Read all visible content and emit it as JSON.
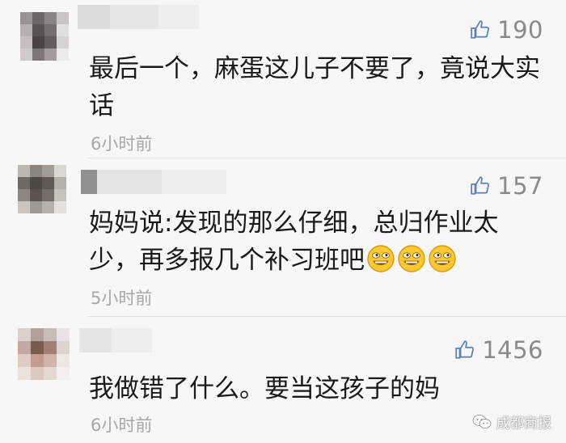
{
  "comments": [
    {
      "likes": "190",
      "text": "最后一个，麻蛋这儿子不要了，竟说大实话",
      "time": "6小时前"
    },
    {
      "likes": "157",
      "text": "妈妈说:发现的那么仔细，总归作业太少，再多报几个补习班吧",
      "time": "5小时前",
      "emoji": [
        "grinning-face",
        "grinning-face",
        "grinning-face"
      ]
    },
    {
      "likes": "1456",
      "text": "我做错了什么。要当这孩子的妈",
      "time": "6小时前"
    }
  ],
  "watermark": {
    "label": "成都商报",
    "icon": "wechat-icon"
  },
  "colors": {
    "background": "#f7f7f7",
    "text": "#1a1a1a",
    "secondary_text": "#8a8a8a",
    "timestamp": "#a7a7a7",
    "like_icon": "#5b7fb8"
  }
}
